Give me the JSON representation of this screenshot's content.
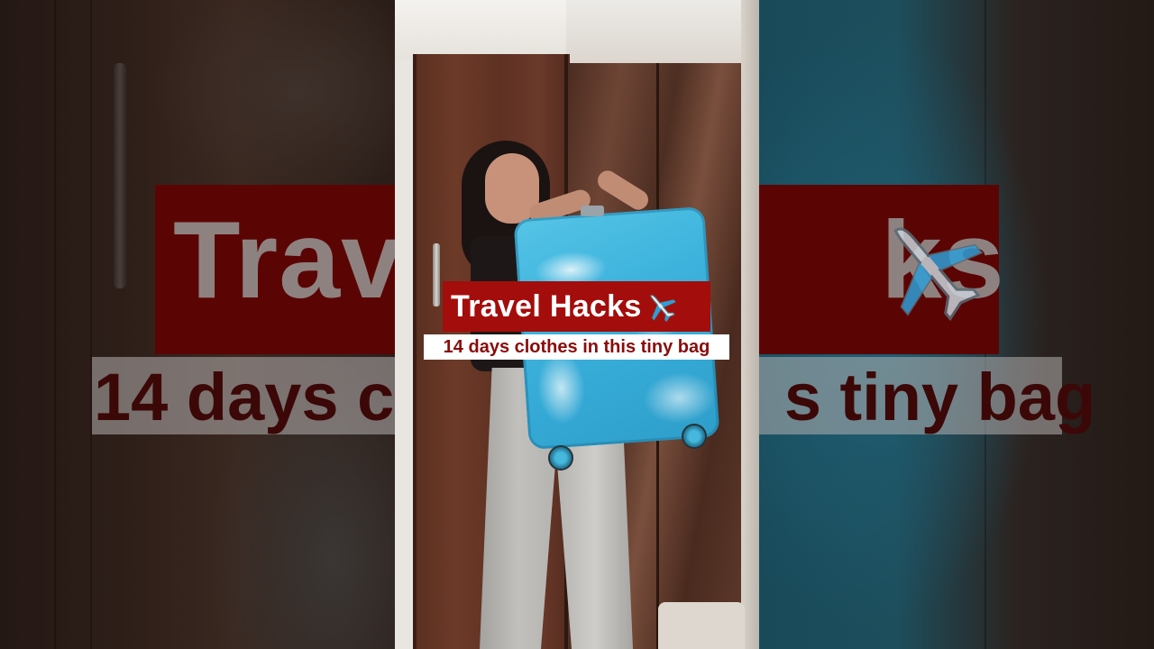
{
  "video": {
    "title_overlay": "Travel Hacks",
    "title_emoji": "airplane-emoji",
    "subtitle_overlay": "14 days clothes in this tiny bag"
  },
  "background_caption": {
    "title_fragment_left": "Trav",
    "title_fragment_right": "ks",
    "subtitle_fragment_left": "14 days cl",
    "subtitle_fragment_right": "s tiny bag"
  },
  "colors": {
    "title_bg": "#a30d0b",
    "title_text": "#ffffff",
    "subtitle_bg": "#ffffff",
    "subtitle_text": "#8a0b0a",
    "suitcase": "#3cb2dc"
  }
}
